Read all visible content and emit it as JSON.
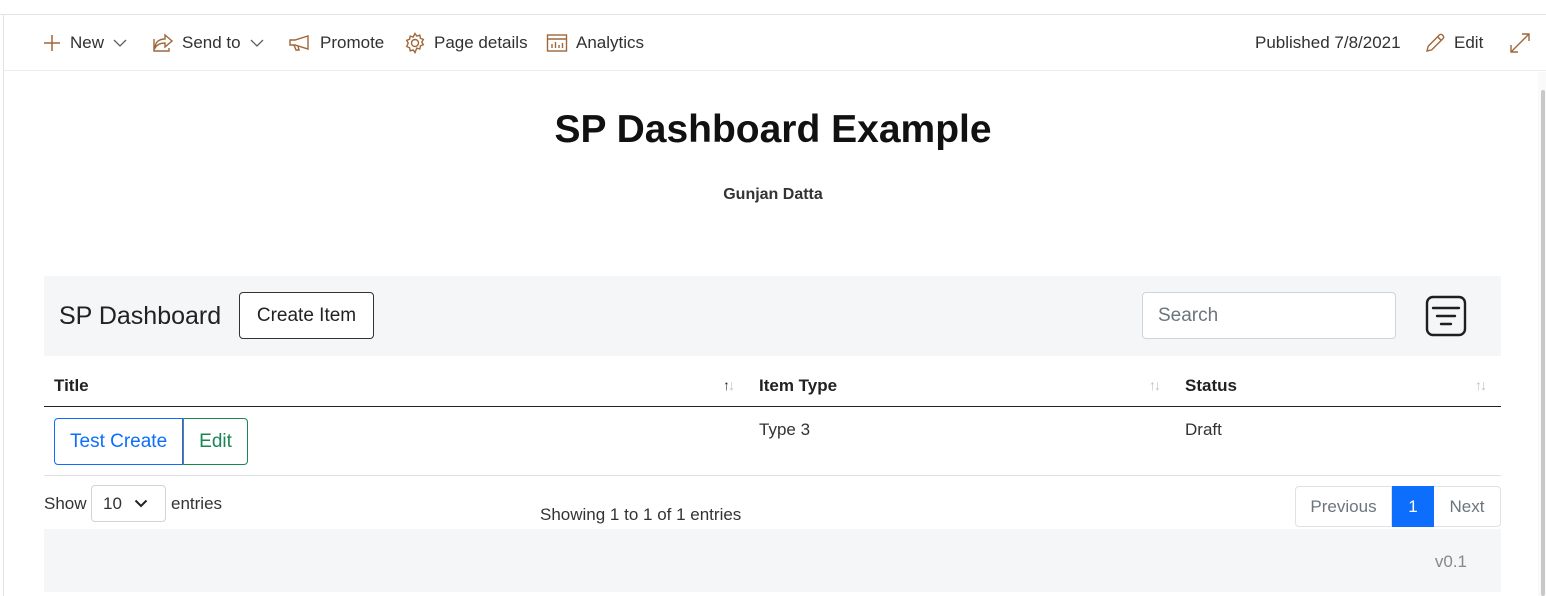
{
  "command_bar": {
    "new_label": "New",
    "send_to_label": "Send to",
    "promote_label": "Promote",
    "page_details_label": "Page details",
    "analytics_label": "Analytics",
    "published_label": "Published 7/8/2021",
    "edit_label": "Edit",
    "icons": [
      "plus-icon",
      "share-icon",
      "megaphone-icon",
      "gear-icon",
      "analytics-icon",
      "pencil-icon",
      "expand-icon",
      "chevron-down-icon"
    ]
  },
  "page": {
    "title": "SP Dashboard Example",
    "author": "Gunjan Datta"
  },
  "dashboard": {
    "title": "SP Dashboard",
    "create_button": "Create Item",
    "search_placeholder": "Search",
    "columns": [
      {
        "label": "Title",
        "sort": "ascending"
      },
      {
        "label": "Item Type",
        "sort": "none"
      },
      {
        "label": "Status",
        "sort": "none"
      }
    ],
    "rows": [
      {
        "title_button": "Test Create",
        "edit_button": "Edit",
        "item_type": "Type 3",
        "status": "Draft"
      }
    ],
    "length_label_before": "Show",
    "length_value": "10",
    "length_label_after": "entries",
    "info": "Showing 1 to 1 of 1 entries",
    "pagination": {
      "previous": "Previous",
      "current": "1",
      "next": "Next"
    },
    "version": "v0.1"
  },
  "colors": {
    "accent_brown": "#a0673a",
    "primary_blue": "#0d6efd",
    "success_green": "#198754",
    "panel_bg": "#f5f6f8"
  }
}
